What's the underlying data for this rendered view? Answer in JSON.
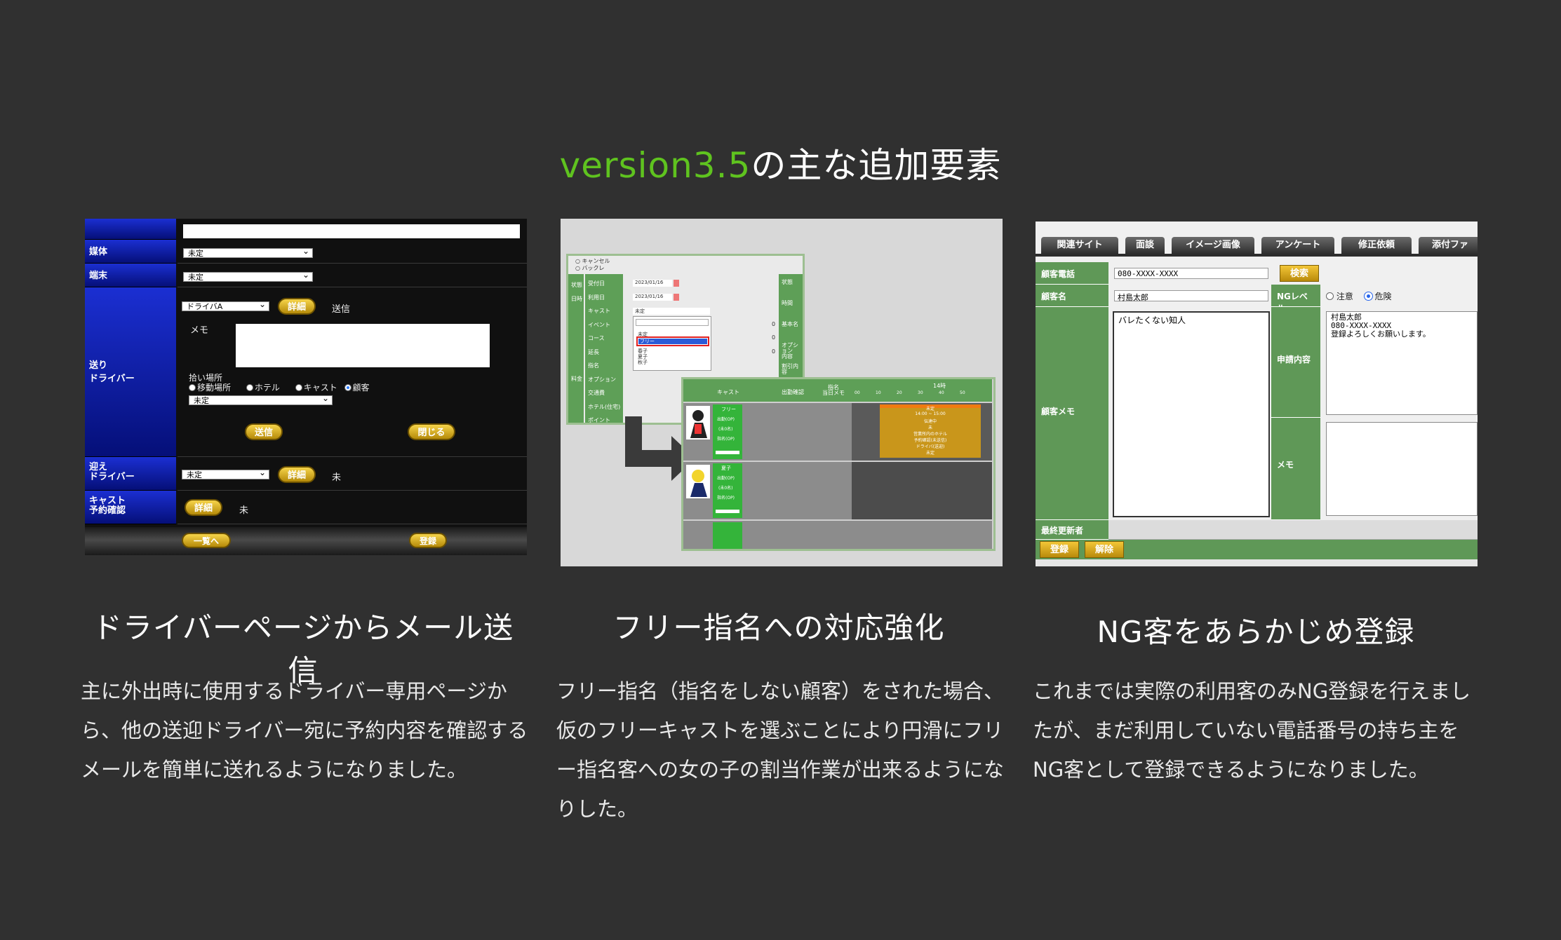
{
  "title": {
    "accent": "version3.5",
    "rest": "の主な追加要素"
  },
  "panels": [
    {
      "caption": "ドライバーページからメール送信",
      "description": "主に外出時に使用するドライバー専用ページから、他の送迎ドライバー宛に予約内容を確認するメールを簡単に送れるようになりました。",
      "ui": {
        "labels": {
          "media": "媒体",
          "terminal": "端末",
          "send_driver": "送り\nドライバー",
          "pickup_driver": "迎え\nドライバー",
          "cast_confirm": "キャスト\n予約確認"
        },
        "media_value": "未定",
        "terminal_value": "未定",
        "driver_select": "ドライバA",
        "detail_btn": "詳細",
        "send_text": "送信",
        "memo_label": "メモ",
        "pickup_place_label": "拾い場所",
        "radios": [
          "移動場所",
          "ホテル",
          "キャスト",
          "顧客"
        ],
        "place_select": "未定",
        "send_btn": "送信",
        "close_btn": "閉じる",
        "pickup_select": "未定",
        "status_un": "未",
        "list_btn": "一覧へ",
        "register_btn": "登録"
      }
    },
    {
      "caption": "フリー指名への対応強化",
      "description": "フリー指名（指名をしない顧客）をされた場合、仮のフリーキャストを選ぶことにより円滑にフリー指名客への女の子の割当作業が出来るようになりした。",
      "ui": {
        "radio_cancel": "キャンセル",
        "radio_back": "バックレ",
        "fields": [
          "受付日",
          "利用日",
          "キャスト",
          "イベント",
          "コース",
          "延長",
          "指名",
          "オプション",
          "交通費",
          "ホテル(住宅)",
          "ポイント"
        ],
        "side_label": "料金",
        "date1": "2023/01/16",
        "date2": "2023/01/16",
        "cast_value": "未定",
        "dropdown": [
          "未定",
          "フリー",
          "春子",
          "夏子",
          "秋子"
        ],
        "right_labels": [
          "状態",
          "時間",
          "基本名",
          "オプション\n内容",
          "割引内容"
        ],
        "zero": "0",
        "grid_headers": [
          "キャスト",
          "出勤確認",
          "指名\n当日メモ"
        ],
        "hour_label": "14時",
        "minutes": [
          "00",
          "10",
          "20",
          "30",
          "40",
          "50"
        ],
        "cast_free": "フリー",
        "cast_status": [
          "出勤(OP)",
          "(未0名)",
          "指名(OP)"
        ],
        "cast2": "夏子",
        "booking": [
          "未定",
          "14:00 ~ 15:00",
          "伝達中",
          "未",
          "営業所内のホテル",
          "予約確認(未送信)",
          "ドライバ(送迎)",
          "未定"
        ]
      }
    },
    {
      "caption": "NG客をあらかじめ登録",
      "description": "これまでは実際の利用客のみNG登録を行えましたが、まだ利用していない電話番号の持ち主をNG客として登録できるようになりました。",
      "ui": {
        "tabs": [
          "関連サイト",
          "面談",
          "イメージ画像",
          "アンケート",
          "修正依頼",
          "添付ファ"
        ],
        "phone_label": "顧客電話",
        "phone_value": "080-XXXX-XXXX",
        "search_btn": "検索",
        "name_label": "顧客名",
        "name_value": "村島太郎",
        "ng_level_label": "NGレベル",
        "ng_options": [
          "注意",
          "危険"
        ],
        "memo_label": "顧客メモ",
        "memo_value": "バレたくない知人",
        "request_label": "申請内容",
        "request_value": "村島太郎\n080-XXXX-XXXX\n登録よろしくお願いします。",
        "memo2_label": "メモ",
        "updater_label": "最終更新者",
        "register_btn": "登録",
        "release_btn": "解除"
      }
    }
  ]
}
